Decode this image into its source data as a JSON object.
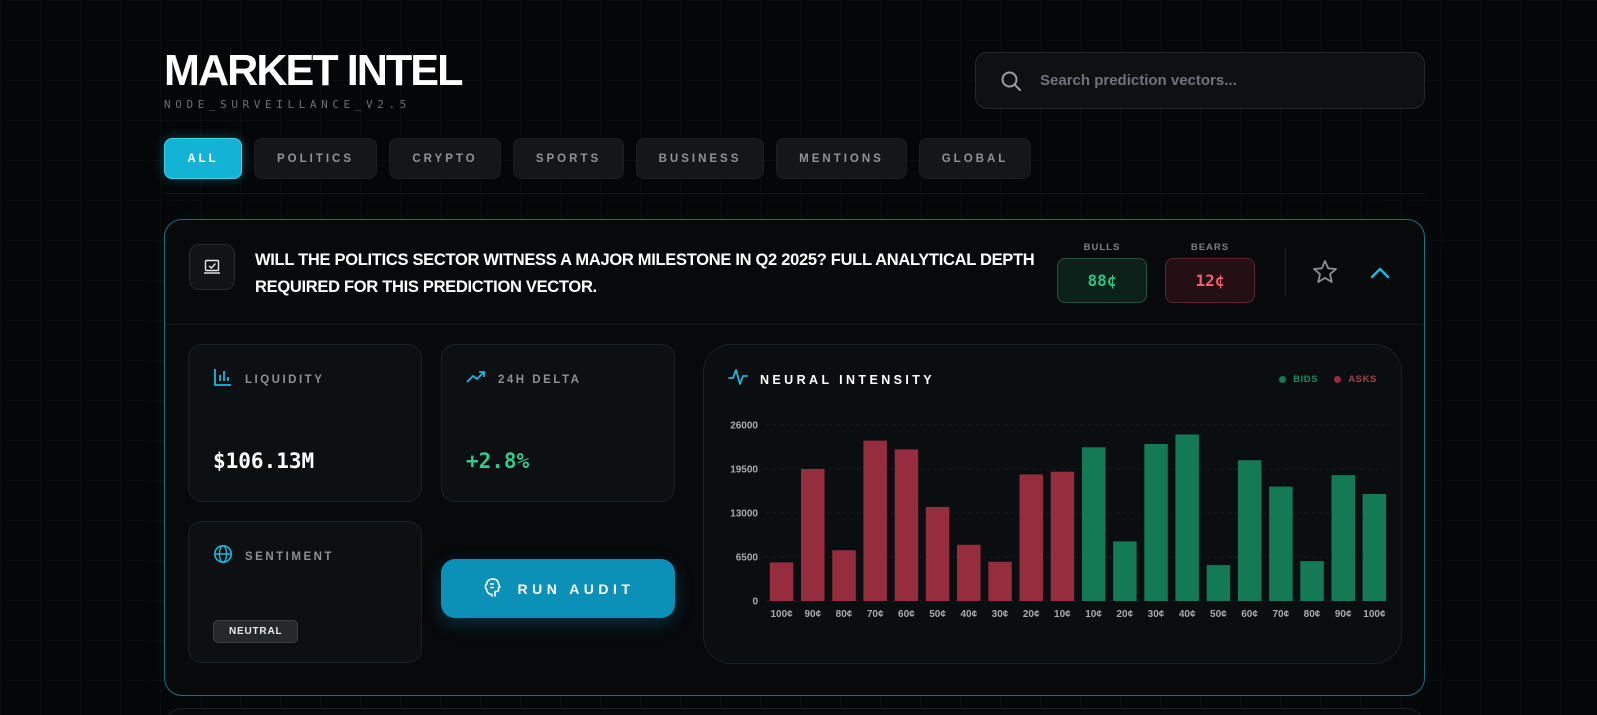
{
  "header": {
    "title": "MARKET INTEL",
    "subtitle": "NODE_SURVEILLANCE_V2.5"
  },
  "search": {
    "placeholder": "Search prediction vectors..."
  },
  "tabs": [
    {
      "label": "ALL",
      "active": true
    },
    {
      "label": "POLITICS",
      "active": false
    },
    {
      "label": "CRYPTO",
      "active": false
    },
    {
      "label": "SPORTS",
      "active": false
    },
    {
      "label": "BUSINESS",
      "active": false
    },
    {
      "label": "MENTIONS",
      "active": false
    },
    {
      "label": "GLOBAL",
      "active": false
    }
  ],
  "market": {
    "question": "WILL THE POLITICS SECTOR WITNESS A MAJOR MILESTONE IN Q2 2025? FULL ANALYTICAL DEPTH REQUIRED FOR THIS PREDICTION VECTOR.",
    "bulls_label": "BULLS",
    "bulls_value": "88¢",
    "bears_label": "BEARS",
    "bears_value": "12¢",
    "liquidity_label": "LIQUIDITY",
    "liquidity_value": "$106.13M",
    "delta_label": "24H DELTA",
    "delta_value": "+2.8%",
    "sentiment_label": "SENTIMENT",
    "sentiment_value": "NEUTRAL",
    "run_audit_label": "RUN AUDIT",
    "chart_title": "NEURAL INTENSITY",
    "legend_bids": "BIDS",
    "legend_asks": "ASKS"
  },
  "colors": {
    "accent": "#13b3d6",
    "bids": "#137a55",
    "asks": "#962d3e",
    "bulls_text": "#2ec27e",
    "bears_text": "#f0606e"
  },
  "icons": {
    "search": "search-icon",
    "question": "chart-check-icon",
    "favorite": "star-icon",
    "collapse": "chevron-up-icon",
    "liquidity": "bar-chart-icon",
    "delta": "trending-up-icon",
    "sentiment": "globe-icon",
    "run_audit": "brain-icon",
    "chart": "activity-icon"
  },
  "chart_data": {
    "type": "bar",
    "title": "NEURAL INTENSITY",
    "xlabel": "",
    "ylabel": "",
    "ylim": [
      0,
      26000
    ],
    "y_ticks": [
      "26000",
      "19500",
      "13000",
      "6500",
      "0"
    ],
    "grid": true,
    "legend_position": "top-right",
    "categories": [
      "100¢",
      "90¢",
      "80¢",
      "70¢",
      "60¢",
      "50¢",
      "40¢",
      "30¢",
      "20¢",
      "10¢",
      "10¢",
      "20¢",
      "30¢",
      "40¢",
      "50¢",
      "60¢",
      "70¢",
      "80¢",
      "90¢",
      "100¢"
    ],
    "series": [
      {
        "name": "ASKS",
        "color": "#962d3e",
        "values": [
          5700,
          19500,
          7500,
          23700,
          22400,
          13900,
          8300,
          5800,
          18700,
          19100,
          null,
          null,
          null,
          null,
          null,
          null,
          null,
          null,
          null,
          null
        ]
      },
      {
        "name": "BIDS",
        "color": "#137a55",
        "values": [
          null,
          null,
          null,
          null,
          null,
          null,
          null,
          null,
          null,
          null,
          22700,
          8800,
          23200,
          24600,
          5300,
          20800,
          16900,
          5900,
          18600,
          15800
        ]
      }
    ]
  }
}
